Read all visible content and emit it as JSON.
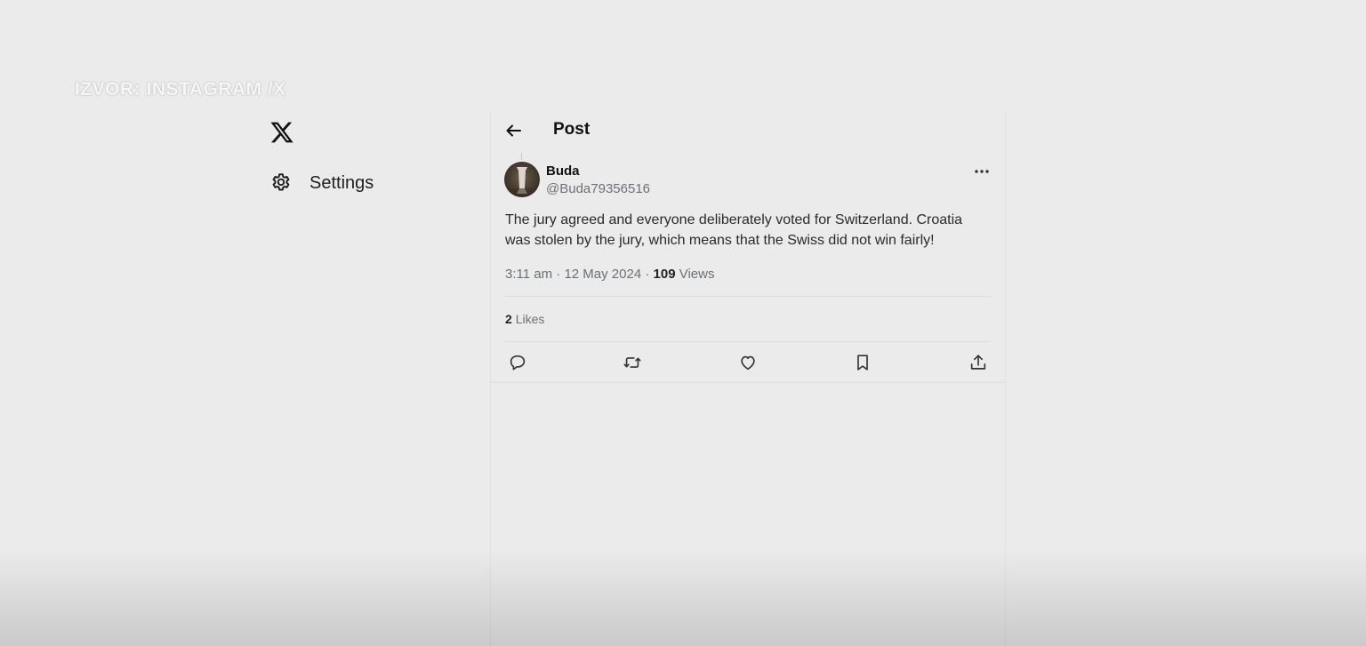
{
  "watermark": "IZVOR: INSTAGRAM /X",
  "sidebar": {
    "logo_icon": "x-logo-icon",
    "settings_label": "Settings"
  },
  "header": {
    "title": "Post"
  },
  "post": {
    "display_name": "Buda",
    "handle": "@Buda79356516",
    "text": "The jury agreed and everyone deliberately voted for Switzerland. Croatia was stolen by the jury, which means that the Swiss did not win fairly!",
    "time": "3:11 am",
    "date": "12 May 2024",
    "views_count": "109",
    "views_label": "Views",
    "likes_count": "2",
    "likes_label": "Likes"
  },
  "actions": [
    "reply-icon",
    "repost-icon",
    "like-icon",
    "bookmark-icon",
    "share-icon"
  ],
  "colors": {
    "background": "#ebebeb",
    "text_primary": "#0f1419",
    "text_secondary": "#6b7177"
  }
}
